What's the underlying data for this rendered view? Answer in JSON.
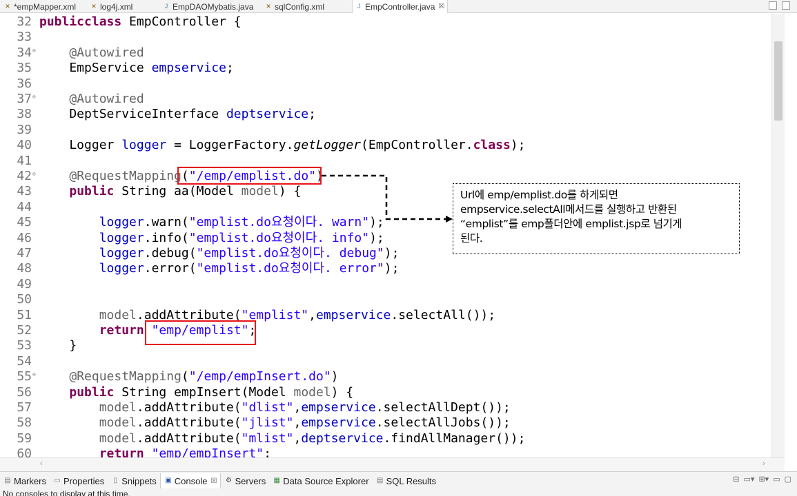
{
  "tabs": [
    {
      "label": "*empMapper.xml",
      "icon": "xml-file-icon"
    },
    {
      "label": "log4j.xml",
      "icon": "xml-file-icon"
    },
    {
      "label": "EmpDAOMybatis.java",
      "icon": "java-file-icon"
    },
    {
      "label": "sqlConfig.xml",
      "icon": "xml-file-icon"
    },
    {
      "label": "EmpController.java",
      "icon": "java-file-icon",
      "active": true,
      "close": "☒"
    }
  ],
  "editor": {
    "line_numbers": [
      "32",
      "33",
      "34",
      "35",
      "36",
      "37",
      "38",
      "39",
      "40",
      "41",
      "42",
      "43",
      "44",
      "45",
      "46",
      "47",
      "48",
      "49",
      "50",
      "51",
      "52",
      "53",
      "54",
      "55",
      "56",
      "57",
      "58",
      "59",
      "60"
    ],
    "lines": [
      [
        [
          "kw",
          "public"
        ],
        [
          "",
          ""
        ],
        [
          "",
          ""
        ],
        [
          "kw",
          "class"
        ],
        [
          "",
          " EmpController {"
        ]
      ],
      [],
      [
        [
          "",
          "    "
        ],
        [
          "ann",
          "@Autowired"
        ]
      ],
      [
        [
          "",
          "    EmpService "
        ],
        [
          "fld",
          "empservice"
        ],
        [
          "",
          ";"
        ]
      ],
      [],
      [
        [
          "",
          "    "
        ],
        [
          "ann",
          "@Autowired"
        ]
      ],
      [
        [
          "",
          "    DeptServiceInterface "
        ],
        [
          "fld",
          "deptservice"
        ],
        [
          "",
          ";"
        ]
      ],
      [],
      [
        [
          "",
          "    Logger "
        ],
        [
          "fld",
          "logger"
        ],
        [
          "",
          " = LoggerFactory."
        ],
        [
          "it",
          "getLogger"
        ],
        [
          "",
          "(EmpController."
        ],
        [
          "kw",
          "class"
        ],
        [
          "",
          ");"
        ]
      ],
      [],
      [
        [
          "",
          "    "
        ],
        [
          "ann",
          "@RequestMapping"
        ],
        [
          "",
          "("
        ],
        [
          "str",
          "\"/emp/emplist.do\""
        ],
        [
          "",
          ")"
        ]
      ],
      [
        [
          "",
          "    "
        ],
        [
          "kw",
          "public"
        ],
        [
          "",
          " String aa(Model "
        ],
        [
          "ann",
          "model"
        ],
        [
          "",
          ") {"
        ]
      ],
      [],
      [
        [
          "",
          "        "
        ],
        [
          "fld",
          "logger"
        ],
        [
          "",
          ".warn("
        ],
        [
          "str",
          "\"emplist.do요청이다. warn\""
        ],
        [
          "",
          ");"
        ]
      ],
      [
        [
          "",
          "        "
        ],
        [
          "fld",
          "logger"
        ],
        [
          "",
          ".info("
        ],
        [
          "str",
          "\"emplist.do요청이다. info\""
        ],
        [
          "",
          ");"
        ]
      ],
      [
        [
          "",
          "        "
        ],
        [
          "fld",
          "logger"
        ],
        [
          "",
          ".debug("
        ],
        [
          "str",
          "\"emplist.do요청이다. debug\""
        ],
        [
          "",
          ");"
        ]
      ],
      [
        [
          "",
          "        "
        ],
        [
          "fld",
          "logger"
        ],
        [
          "",
          ".error("
        ],
        [
          "str",
          "\"emplist.do요청이다. error\""
        ],
        [
          "",
          ");"
        ]
      ],
      [],
      [],
      [
        [
          "",
          "        "
        ],
        [
          "ann",
          "model"
        ],
        [
          "",
          ".addAttribute("
        ],
        [
          "str",
          "\"emplist\""
        ],
        [
          "",
          ","
        ],
        [
          "fld",
          "empservice"
        ],
        [
          "",
          ".selectAll());"
        ]
      ],
      [
        [
          "",
          "        "
        ],
        [
          "kw",
          "return"
        ],
        [
          "",
          " "
        ],
        [
          "str",
          "\"emp/emplist\""
        ],
        [
          "",
          ";"
        ]
      ],
      [
        [
          "",
          "    }"
        ]
      ],
      [],
      [
        [
          "",
          "    "
        ],
        [
          "ann",
          "@RequestMapping"
        ],
        [
          "",
          "("
        ],
        [
          "str",
          "\"/emp/empInsert.do\""
        ],
        [
          "",
          ")"
        ]
      ],
      [
        [
          "",
          "    "
        ],
        [
          "kw",
          "public"
        ],
        [
          "",
          " String empInsert(Model "
        ],
        [
          "ann",
          "model"
        ],
        [
          "",
          ") {"
        ]
      ],
      [
        [
          "",
          "        "
        ],
        [
          "ann",
          "model"
        ],
        [
          "",
          ".addAttribute("
        ],
        [
          "str",
          "\"dlist\""
        ],
        [
          "",
          ","
        ],
        [
          "fld",
          "empservice"
        ],
        [
          "",
          ".selectAllDept());"
        ]
      ],
      [
        [
          "",
          "        "
        ],
        [
          "ann",
          "model"
        ],
        [
          "",
          ".addAttribute("
        ],
        [
          "str",
          "\"jlist\""
        ],
        [
          "",
          ","
        ],
        [
          "fld",
          "empservice"
        ],
        [
          "",
          ".selectAllJobs());"
        ]
      ],
      [
        [
          "",
          "        "
        ],
        [
          "ann",
          "model"
        ],
        [
          "",
          ".addAttribute("
        ],
        [
          "str",
          "\"mlist\""
        ],
        [
          "",
          ","
        ],
        [
          "fld",
          "deptservice"
        ],
        [
          "",
          ".findAllManager());"
        ]
      ],
      [
        [
          "",
          "        "
        ],
        [
          "kw",
          "return"
        ],
        [
          "",
          " "
        ],
        [
          "str",
          "\"emp/empInsert\""
        ],
        [
          "",
          ";"
        ]
      ]
    ],
    "fold_markers": [
      "34",
      "37",
      "42",
      "55"
    ]
  },
  "note": {
    "lines": [
      "Url에 emp/emplist.do를 하게되면",
      "empservice.selectAll메서드를 실행하고 반환된",
      "“emplist”를 emp폴더안에 emplist.jsp로 넘기게",
      "된다."
    ]
  },
  "colors": {
    "highlight": "#e8121a",
    "keyword": "#7f0055",
    "string": "#2a00ff",
    "field": "#0000c0",
    "annotation": "#646464"
  },
  "panel": {
    "tabs": [
      {
        "label": "Markers",
        "icon": "markers-icon"
      },
      {
        "label": "Properties",
        "icon": "properties-icon"
      },
      {
        "label": "Snippets",
        "icon": "snippets-icon"
      },
      {
        "label": "Console",
        "icon": "console-icon",
        "active": true,
        "close": "☒"
      },
      {
        "label": "Servers",
        "icon": "servers-icon"
      },
      {
        "label": "Data Source Explorer",
        "icon": "data-source-icon"
      },
      {
        "label": "SQL Results",
        "icon": "sql-results-icon"
      }
    ],
    "message": "No consoles to display at this time."
  }
}
